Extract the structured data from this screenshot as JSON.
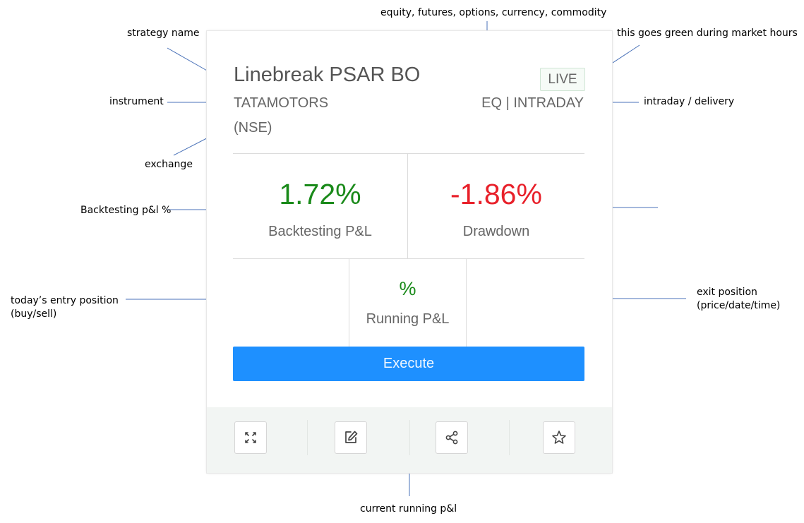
{
  "annotations": {
    "strategy_name": "strategy name",
    "asset_class": "equity, futures, options, currency, commodity",
    "live_hint": "this goes green during market hours",
    "instrument": "instrument",
    "product_type": "intraday / delivery",
    "exchange": "exchange",
    "backtest_pnl_pct": "Backtesting p&l %",
    "entry_position_line1": "today’s entry position",
    "entry_position_line2": "(buy/sell)",
    "exit_position_line1": "exit position",
    "exit_position_line2": "(price/date/time)",
    "running_pnl": "current running p&l"
  },
  "card": {
    "title": "Linebreak PSAR BO",
    "badge": "LIVE",
    "instrument": "TATAMOTORS",
    "exchange": "(NSE)",
    "segment": "EQ | INTRADAY",
    "backtest_value": "1.72%",
    "backtest_label": "Backtesting P&L",
    "drawdown_value": "-1.86%",
    "drawdown_label": "Drawdown",
    "running_value": "%",
    "running_label": "Running P&L",
    "execute_label": "Execute"
  },
  "colors": {
    "positive": "#1a8a1a",
    "negative": "#e8202a",
    "execute_button": "#1e90ff"
  },
  "footer_icons": [
    "expand-icon",
    "edit-icon",
    "share-icon",
    "star-icon"
  ]
}
